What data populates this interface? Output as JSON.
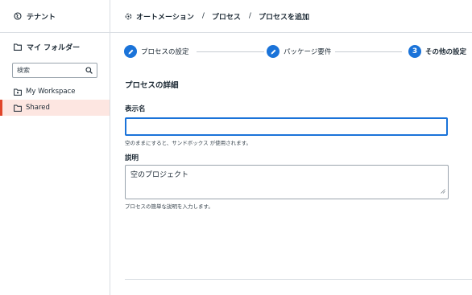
{
  "sidebar": {
    "tenant_label": "テナント",
    "folders_header": "マイ フォルダー",
    "search_placeholder": "検索",
    "items": [
      {
        "label": "My Workspace",
        "active": false
      },
      {
        "label": "Shared",
        "active": true
      }
    ]
  },
  "breadcrumb": {
    "items": [
      "オートメーション",
      "プロセス",
      "プロセスを追加"
    ],
    "separator": "/"
  },
  "stepper": {
    "steps": [
      {
        "label": "プロセスの設定",
        "state": "completed",
        "marker": ""
      },
      {
        "label": "パッケージ要件",
        "state": "completed",
        "marker": ""
      },
      {
        "label": "その他の設定",
        "state": "current",
        "marker": "3"
      }
    ]
  },
  "form": {
    "section_title": "プロセスの詳細",
    "display_name": {
      "label": "表示名",
      "value": "",
      "help": "空のままにすると、サンドボックス が使用されます。"
    },
    "description": {
      "label": "説明",
      "value": "空のプロジェクト",
      "help": "プロセスの簡単な説明を入力します。"
    }
  },
  "colors": {
    "accent": "#1a73d9",
    "active_bg": "#fde6e1",
    "active_bar": "#e0452a",
    "border": "#d8dde2"
  }
}
